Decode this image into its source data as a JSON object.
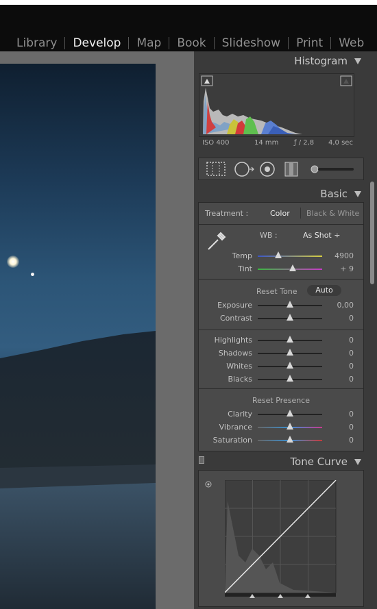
{
  "modules": {
    "items": [
      "Library",
      "Develop",
      "Map",
      "Book",
      "Slideshow",
      "Print",
      "Web"
    ],
    "active": "Develop"
  },
  "histogram": {
    "title": "Histogram",
    "iso": "ISO 400",
    "focal": "14 mm",
    "aperture": "ƒ / 2,8",
    "shutter": "4,0 sec"
  },
  "basic": {
    "title": "Basic",
    "treatment_label": "Treatment :",
    "treatment_color": "Color",
    "treatment_bw": "Black & White",
    "wb_label": "WB :",
    "wb_value": "As Shot ÷",
    "temp_label": "Temp",
    "temp_value": "4900",
    "temp_pos": 0.32,
    "tint_label": "Tint",
    "tint_value": "+ 9",
    "tint_pos": 0.54,
    "reset_tone": "Reset Tone",
    "auto": "Auto",
    "exposure_label": "Exposure",
    "exposure_value": "0,00",
    "contrast_label": "Contrast",
    "contrast_value": "0",
    "highlights_label": "Highlights",
    "highlights_value": "0",
    "shadows_label": "Shadows",
    "shadows_value": "0",
    "whites_label": "Whites",
    "whites_value": "0",
    "blacks_label": "Blacks",
    "blacks_value": "0",
    "reset_presence": "Reset Presence",
    "clarity_label": "Clarity",
    "clarity_value": "0",
    "vibrance_label": "Vibrance",
    "vibrance_value": "0",
    "saturation_label": "Saturation",
    "saturation_value": "0"
  },
  "tone_curve": {
    "title": "Tone Curve"
  },
  "colors": {
    "panel_bg": "#3a3a3a",
    "subpanel_bg": "#4a4a4a",
    "active_text": "#f0f0f0",
    "inactive_text": "#8f8f8f"
  }
}
